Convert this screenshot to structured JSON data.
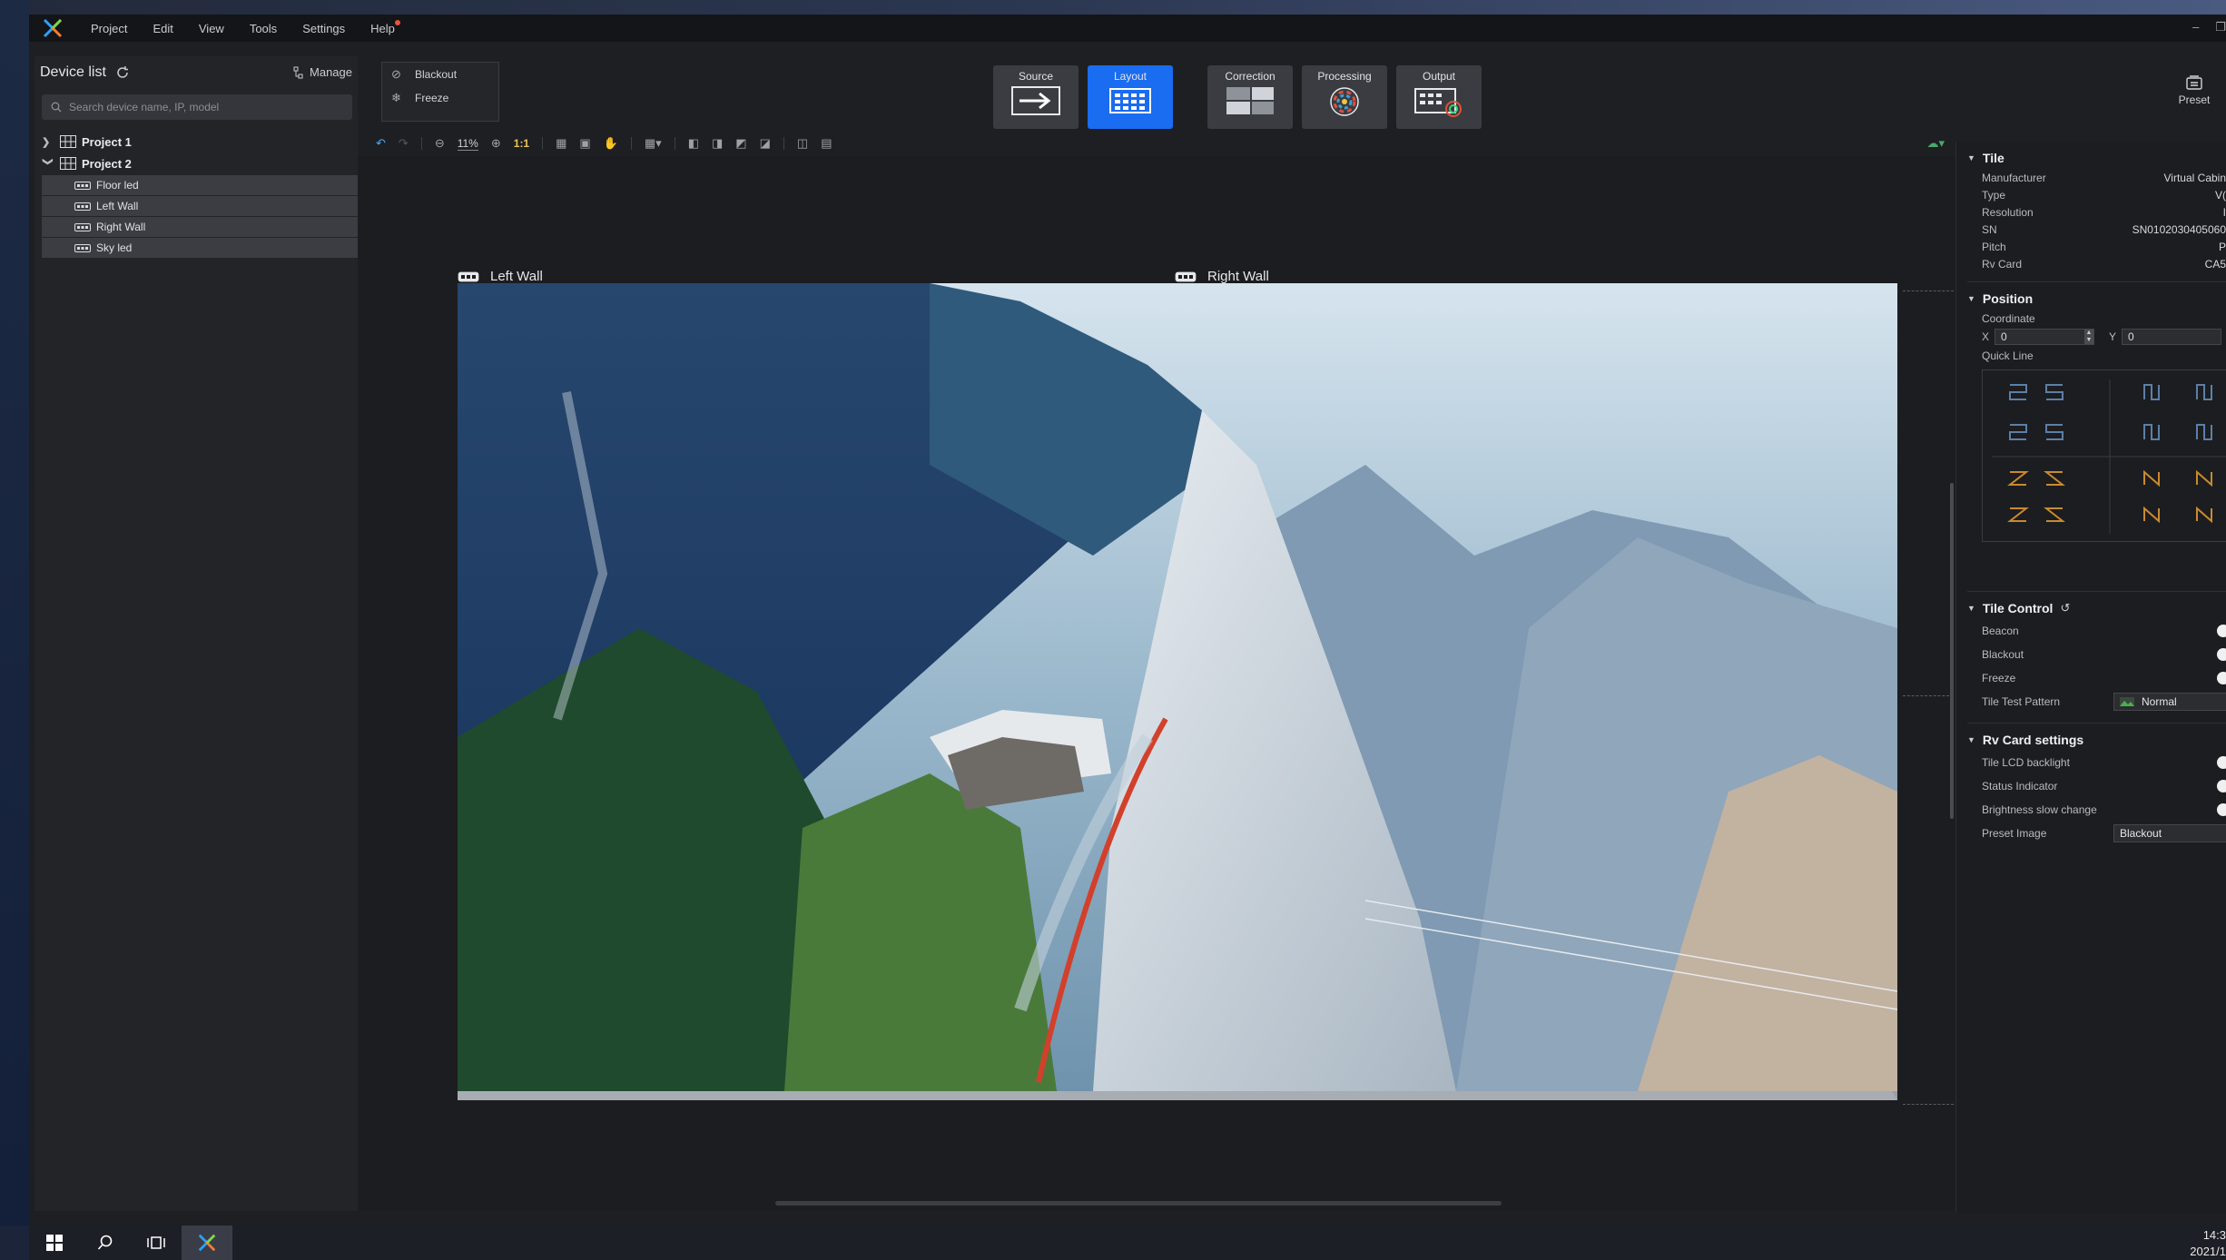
{
  "menu": {
    "items": [
      "Project",
      "Edit",
      "View",
      "Tools",
      "Settings",
      "Help"
    ],
    "window_minimize": "–",
    "window_restore": "❐"
  },
  "device_panel": {
    "title": "Device list",
    "manage_label": "Manage",
    "search_placeholder": "Search device name, IP, model",
    "projects": [
      {
        "name": "Project 1",
        "expanded": false,
        "devices": []
      },
      {
        "name": "Project 2",
        "expanded": true,
        "devices": [
          "Floor led",
          "Left Wall",
          "Right Wall",
          "Sky led"
        ]
      }
    ]
  },
  "ribbon": {
    "blackout_label": "Blackout",
    "freeze_label": "Freeze",
    "modes": [
      {
        "label": "Source",
        "active": false
      },
      {
        "label": "Layout",
        "active": true
      },
      {
        "label": "Correction",
        "active": false
      },
      {
        "label": "Processing",
        "active": false
      },
      {
        "label": "Output",
        "active": false
      }
    ],
    "preset_label": "Preset"
  },
  "toolbar": {
    "zoom_value": "11%",
    "one_to_one": "1:1"
  },
  "canvas": {
    "left_wall_label": "Left Wall",
    "right_wall_label": "Right Wall"
  },
  "properties": {
    "tile": {
      "title": "Tile",
      "fields": [
        {
          "label": "Manufacturer",
          "value": "Virtual Cabin"
        },
        {
          "label": "Type",
          "value": "V("
        },
        {
          "label": "Resolution",
          "value": "I"
        },
        {
          "label": "SN",
          "value": "SN0102030405060"
        },
        {
          "label": "Pitch",
          "value": "P"
        },
        {
          "label": "Rv Card",
          "value": "CA5"
        }
      ]
    },
    "position": {
      "title": "Position",
      "coordinate_label": "Coordinate",
      "x_label": "X",
      "x_value": "0",
      "y_label": "Y",
      "y_value": "0",
      "quick_line_label": "Quick Line"
    },
    "tile_control": {
      "title": "Tile Control",
      "beacon": "Beacon",
      "blackout": "Blackout",
      "freeze": "Freeze",
      "test_pattern_label": "Tile Test Pattern",
      "test_pattern_value": "Normal"
    },
    "rv_card": {
      "title": "Rv Card settings",
      "lcd_backlight": "Tile LCD backlight",
      "status_indicator": "Status Indicator",
      "brightness_slow": "Brightness slow change",
      "preset_image_label": "Preset Image",
      "preset_image_value": "Blackout"
    }
  },
  "taskbar": {
    "time": "14:3",
    "date": "2021/1"
  },
  "colors": {
    "accent": "#1a6cf0",
    "panel": "#232428",
    "window": "#1e1f22"
  }
}
